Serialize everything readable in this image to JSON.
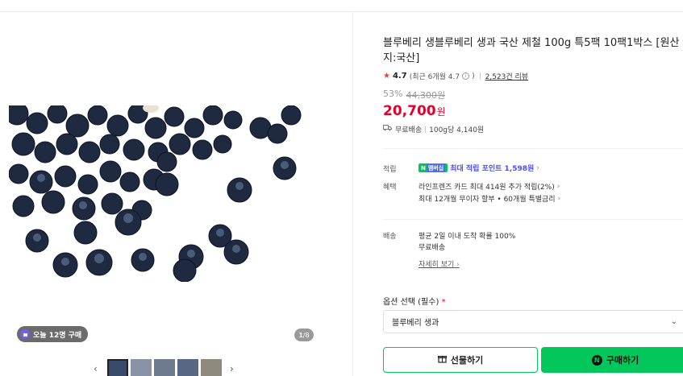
{
  "product": {
    "title": "블루베리 생블루베리 생과 국산 제철 100g 특5팩 10팩1박스 [원산지:국산]",
    "rating": "4.7",
    "rating_recent": "(최근 6개월 4.7",
    "rating_info": "i",
    "rating_close": ")",
    "review_count": "2,523건 리뷰",
    "discount_rate": "53%",
    "original_price": "44,300원",
    "price": "20,700",
    "price_unit": "원",
    "shipping": "무료배송",
    "unit_price": "100g당 4,140원"
  },
  "gallery": {
    "buy_badge": "오늘 12명 구매",
    "counter_current": "1",
    "counter_total": "/8",
    "prev_label": "‹",
    "next_label": "›"
  },
  "benefits": {
    "label_points": "적립",
    "npay_badge": "N",
    "npay_plus": "멤버십",
    "points_text": "최대 적립 포인트 1,598원",
    "label_benefit": "혜택",
    "benefit_1": "라인프렌즈 카드 최대 414원 추가 적립(2%)",
    "benefit_2": "최대 12개월 무이자 할부 • 60개월 특별금리",
    "chevron": "›"
  },
  "delivery": {
    "label": "배송",
    "line_1": "평균 2일 이내 도착 확률 100%",
    "line_2": "무료배송",
    "more": "자세히 보기"
  },
  "option": {
    "label": "옵션 선택 (필수)",
    "required_mark": "*",
    "selected": "블루베리 생과",
    "arrow": "⌄"
  },
  "actions": {
    "gift": "선물하기",
    "buy": "구매하기",
    "n_mark": "N"
  },
  "colors": {
    "price_red": "#e4002b",
    "naver_green": "#03c75a",
    "point_blue": "#4d4dff"
  }
}
